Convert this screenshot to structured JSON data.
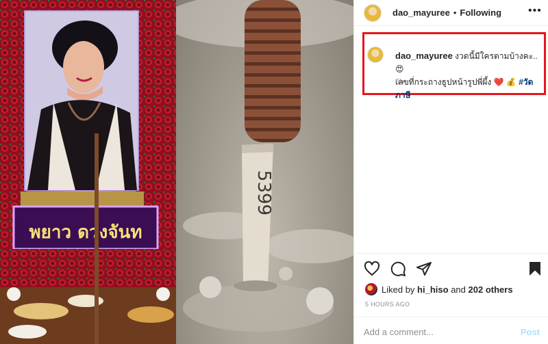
{
  "post": {
    "username": "dao_mayuree",
    "separator": "•",
    "follow_state": "Following",
    "more_icon": "more-horizontal-icon"
  },
  "caption": {
    "username": "dao_mayuree",
    "line1": "งวดนี้มีใครตามบ้างคะ..",
    "emoji1": "😍",
    "line2": "เลขที่กระถางธูปหน้ารูปพี่ผึ้ง",
    "heart": "❤️",
    "emoji2": "💰",
    "hashtag": "#วัดภาษี",
    "time": "5h"
  },
  "photo": {
    "frame_text": "พยาว ดวงจันท",
    "incense_number": "5399"
  },
  "actions": {
    "like_icon": "heart-outline-icon",
    "comment_icon": "comment-icon",
    "share_icon": "paper-plane-icon",
    "save_icon": "bookmark-icon"
  },
  "likes": {
    "prefix": "Liked by",
    "user": "hi_hiso",
    "conj": "and",
    "others": "202 others"
  },
  "timestamp": "5 HOURS AGO",
  "comment_input": {
    "placeholder": "Add a comment...",
    "post_label": "Post"
  },
  "colors": {
    "highlight_box": "#e3161c",
    "hashtag": "#00376b",
    "post_button_disabled": "#b2dffc"
  }
}
